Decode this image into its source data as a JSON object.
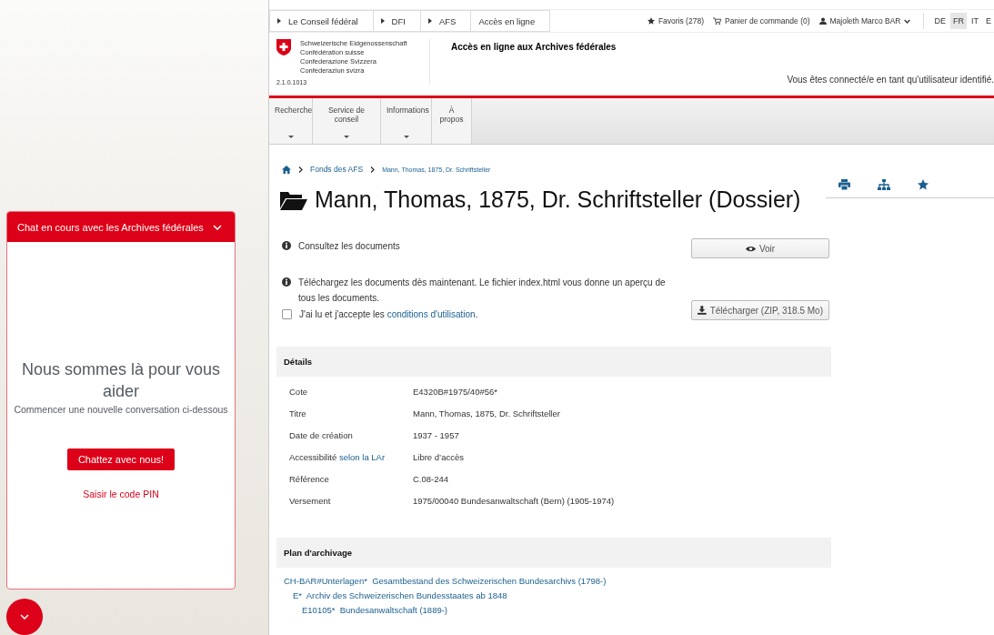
{
  "chat": {
    "header": "Chat en cours avec les Archives fédérales",
    "expanded": true,
    "heading": "Nous sommes là pour vous aider",
    "subtitle": "Commencer une nouvelle conversation ci-dessous",
    "button": "Chattez avec nous!",
    "pin_link": "Saisir le code PIN"
  },
  "topbar": {
    "breadcrumbs": [
      "Le Conseil fédéral",
      "DFI",
      "AFS",
      "Accès en ligne"
    ],
    "favorites": "Favoris (278)",
    "cart": "Panier de commande (0)",
    "user": "Majoleth Marco BAR",
    "languages": [
      {
        "label": "DE",
        "selected": false
      },
      {
        "label": "FR",
        "selected": true
      },
      {
        "label": "IT",
        "selected": false
      },
      {
        "label": "E",
        "selected": false
      }
    ]
  },
  "header": {
    "logo_lines": [
      "Schweizerische Eidgenossenschaft",
      "Confédération suisse",
      "Confederazione Svizzera",
      "Confederaziun svizra"
    ],
    "version": "2.1.0.1013",
    "site_title": "Accès en ligne aux Archives fédérales",
    "login_status": "Vous êtes connecté/e en tant qu'utilisateur identifié."
  },
  "nav": [
    {
      "label": "Recherche",
      "dropdown": true
    },
    {
      "label": "Service de conseil",
      "dropdown": true
    },
    {
      "label": "Informations",
      "dropdown": true
    },
    {
      "label": "À propos",
      "dropdown": false
    }
  ],
  "breadcrumb": [
    "Fonds des AFS",
    "Mann, Thomas, 1875, Dr. Schriftsteller"
  ],
  "title": "Mann, Thomas, 1875, Dr. Schriftsteller (Dossier)",
  "access": {
    "view_text": "Consultez les documents",
    "view_button": "Voir",
    "download_text": "Téléchargez les documents dès maintenant. Le fichier index.html vous donne un aperçu de tous les documents.",
    "terms_checked": false,
    "terms_text": "J'ai lu et j'accepte les",
    "terms_link": "conditions d'utilisation",
    "terms_end": ".",
    "download_button": "Télécharger (ZIP, 318.5 Mo)"
  },
  "details": {
    "heading": "Détails",
    "rows": [
      {
        "label": "Cote",
        "value": "E4320B#1975/40#56*"
      },
      {
        "label": "Titre",
        "value": "Mann, Thomas, 1875, Dr. Schriftsteller"
      },
      {
        "label": "Date de création",
        "value": "1937 - 1957"
      },
      {
        "label": "Accessibilité",
        "label_link": "selon la LAr",
        "value": "Libre d’accès"
      },
      {
        "label": "Référence",
        "value": "C.08-244"
      },
      {
        "label": "Versement",
        "value": "1975/00040 Bundesanwaltschaft (Bern) (1905-1974)"
      }
    ]
  },
  "archive_plan": {
    "heading": "Plan d'archivage",
    "items": [
      {
        "label": "CH-BAR#Unterlagen*  Gesamtbestand des Schweizerischen Bundesarchivs (1798-)",
        "children": [
          {
            "label": "E*  Archiv des Schweizerischen Bundesstaates ab 1848",
            "children": [
              {
                "label": "E10105*  Bundesanwaltschaft (1889-)"
              }
            ]
          }
        ]
      }
    ]
  }
}
